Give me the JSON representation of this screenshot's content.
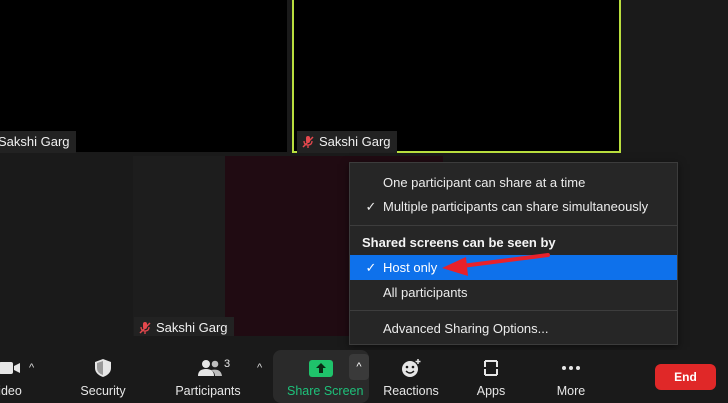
{
  "tiles": {
    "top_left_name": "Sakshi Garg",
    "top_right_name": "Sakshi Garg",
    "middle_name": "Sakshi Garg"
  },
  "share_menu": {
    "items": [
      {
        "label": "One participant can share at a time",
        "checked": false
      },
      {
        "label": "Multiple participants can share simultaneously",
        "checked": true
      }
    ],
    "heading": "Shared screens can be seen by",
    "visibility_items": [
      {
        "label": "Host only",
        "checked": true,
        "selected": true
      },
      {
        "label": "All participants",
        "checked": false
      }
    ],
    "advanced_label": "Advanced Sharing Options...",
    "check_glyph": "✓"
  },
  "toolbar": {
    "video_label": "ideo",
    "security_label": "Security",
    "participants_label": "Participants",
    "participants_count": "3",
    "share_label": "Share Screen",
    "reactions_label": "Reactions",
    "apps_label": "Apps",
    "more_label": "More",
    "end_label": "End"
  },
  "colors": {
    "active_speaker_border": "#b9de3e",
    "menu_selected": "#0e71eb",
    "share_green": "#1fc36b",
    "end_red": "#e02828",
    "annotation_arrow": "#e8212b"
  }
}
